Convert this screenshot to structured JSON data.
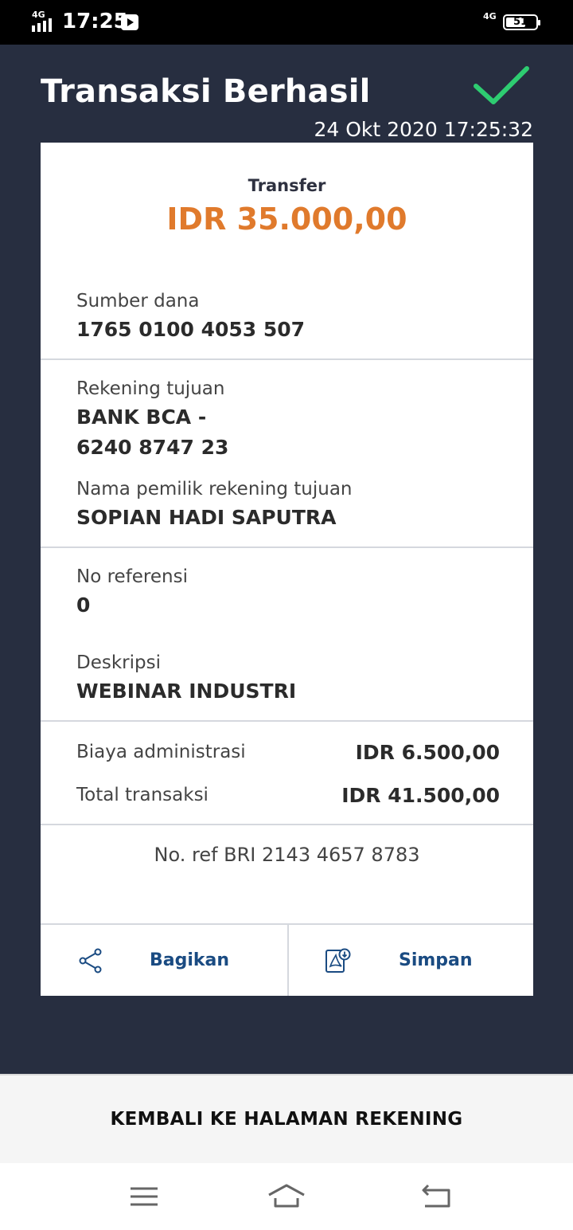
{
  "status_bar": {
    "network_left": "4G",
    "time": "17:25",
    "network_right": "4G",
    "battery": "51"
  },
  "header": {
    "title": "Transaksi Berhasil",
    "datetime": "24 Okt 2020 17:25:32",
    "success_icon": "checkmark-icon",
    "accent_color": "#2ecc71"
  },
  "receipt": {
    "type": "Transfer",
    "amount": "IDR 35.000,00",
    "amount_color": "#e07a2c",
    "source_label": "Sumber dana",
    "source_value": "1765 0100 4053 507",
    "dest_label": "Rekening tujuan",
    "dest_bank": "BANK BCA -",
    "dest_account": "6240 8747 23",
    "owner_label": "Nama pemilik rekening tujuan",
    "owner_value": "SOPIAN HADI SAPUTRA",
    "reference_label": "No referensi",
    "reference_value": "0",
    "description_label": "Deskripsi",
    "description_value": "WEBINAR INDUSTRI",
    "admin_fee_label": "Biaya administrasi",
    "admin_fee_value": "IDR 6.500,00",
    "total_label": "Total transaksi",
    "total_value": "IDR 41.500,00",
    "bri_ref": "No. ref BRI 2143 4657 8783"
  },
  "actions": {
    "share_label": "Bagikan",
    "save_label": "Simpan"
  },
  "footer": {
    "back_label": "KEMBALI KE HALAMAN REKENING"
  },
  "colors": {
    "background": "#272e40",
    "link": "#1a4b82"
  }
}
